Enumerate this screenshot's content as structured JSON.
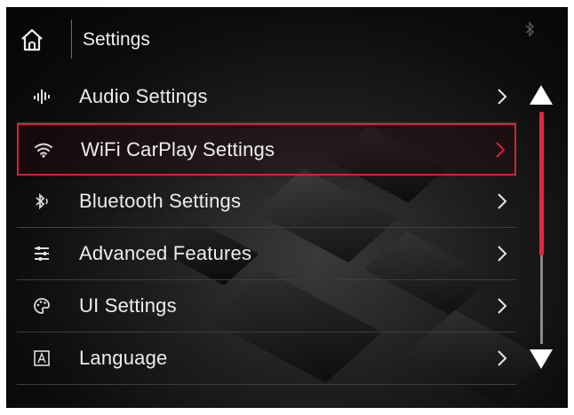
{
  "header": {
    "title": "Settings"
  },
  "menu": {
    "items": [
      {
        "label": "Audio Settings",
        "icon": "audio-levels-icon"
      },
      {
        "label": "WiFi CarPlay Settings",
        "icon": "wifi-icon",
        "selected": true
      },
      {
        "label": "Bluetooth Settings",
        "icon": "bluetooth-icon"
      },
      {
        "label": "Advanced Features",
        "icon": "sliders-icon"
      },
      {
        "label": "UI Settings",
        "icon": "palette-icon"
      },
      {
        "label": "Language",
        "icon": "language-a-icon"
      }
    ]
  },
  "scrollbar": {
    "position": 0.0,
    "visible_fraction": 0.62
  },
  "colors": {
    "accent": "#d2233a",
    "background": "#0c0c0c",
    "text": "#ededed"
  }
}
